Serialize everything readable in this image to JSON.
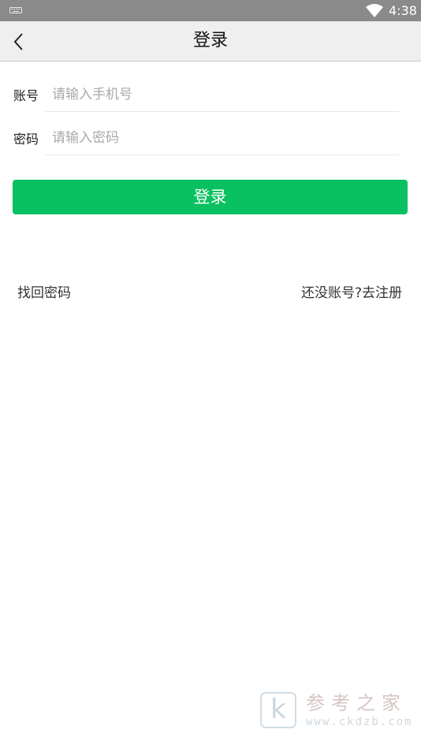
{
  "status_bar": {
    "time": "4:38",
    "icons": [
      "keyboard-icon",
      "wifi-icon"
    ]
  },
  "app_bar": {
    "title": "登录",
    "back_icon": "chevron-left-icon"
  },
  "form": {
    "account": {
      "label": "账号",
      "placeholder": "请输入手机号",
      "value": ""
    },
    "password": {
      "label": "密码",
      "placeholder": "请输入密码",
      "value": ""
    },
    "login_button": "登录"
  },
  "links": {
    "recover_password": "找回密码",
    "register": "还没账号?去注册"
  },
  "watermark": {
    "logo_letter": "k",
    "title": "参考之家",
    "url": "www.ckdzb.com"
  },
  "colors": {
    "status_bar_bg": "#8a8a8a",
    "app_bar_bg": "#efefef",
    "primary_green": "#09c160",
    "placeholder_text": "#a9a9a9"
  }
}
